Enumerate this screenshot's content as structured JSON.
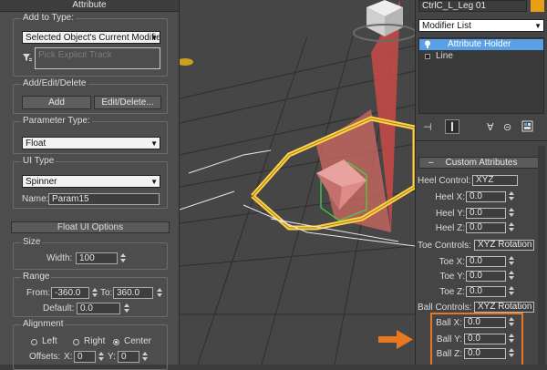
{
  "left_panel": {
    "title": "Attribute",
    "add_to_type": {
      "label": "Add to Type:",
      "selected": "Selected Object's Current Modifier",
      "pick_placeholder": "Pick Explicit Track"
    },
    "add_edit_delete": {
      "label": "Add/Edit/Delete",
      "add_button": "Add",
      "edit_delete_button": "Edit/Delete..."
    },
    "parameter_type": {
      "label": "Parameter Type:",
      "selected": "Float"
    },
    "ui_type": {
      "label": "UI Type",
      "selected": "Spinner",
      "name_label": "Name:",
      "name_value": "Param15"
    },
    "float_ui_options": {
      "title": "Float UI Options",
      "size": {
        "label": "Size",
        "width_label": "Width:",
        "width_value": "100"
      },
      "range": {
        "label": "Range",
        "from_label": "From:",
        "from_value": "-360.0",
        "to_label": "To:",
        "to_value": "360.0",
        "default_label": "Default:",
        "default_value": "0.0"
      },
      "alignment": {
        "label": "Alignment",
        "left": "Left",
        "right": "Right",
        "center": "Center",
        "selected": "Center",
        "offsets_label": "Offsets:",
        "x_label": "X:",
        "x_value": "0",
        "y_label": "Y:",
        "y_value": "0"
      }
    }
  },
  "right_panel": {
    "object_name": "CtrlC_L_Leg 01",
    "object_color": "#e8a010",
    "modifier_list_label": "Modifier List",
    "stack": [
      {
        "label": "Attribute Holder",
        "selected": true
      },
      {
        "label": "Line",
        "selected": false
      }
    ],
    "custom_attributes": {
      "title": "Custom Attributes",
      "heel_control_label": "Heel Control:",
      "heel_control_value": "XYZ",
      "heel_x_label": "Heel X:",
      "heel_x_value": "0.0",
      "heel_y_label": "Heel Y:",
      "heel_y_value": "0.0",
      "heel_z_label": "Heel Z:",
      "heel_z_value": "0.0",
      "toe_controls_label": "Toe Controls:",
      "toe_controls_value": "XYZ Rotation",
      "toe_x_label": "Toe X:",
      "toe_x_value": "0.0",
      "toe_y_label": "Toe Y:",
      "toe_y_value": "0.0",
      "toe_z_label": "Toe Z:",
      "toe_z_value": "0.0",
      "ball_controls_label": "Ball Controls:",
      "ball_controls_value": "XYZ Rotation",
      "ball_x_label": "Ball X:",
      "ball_x_value": "0.0",
      "ball_y_label": "Ball Y:",
      "ball_y_value": "0.0",
      "ball_z_label": "Ball Z:",
      "ball_z_value": "0.0"
    }
  },
  "colors": {
    "highlight": "#e87722",
    "selection": "#5aa0e6"
  }
}
